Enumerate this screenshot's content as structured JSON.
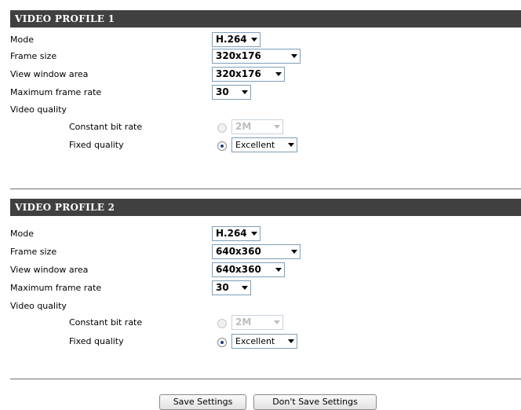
{
  "profiles": [
    {
      "title": "VIDEO PROFILE 1",
      "mode_label": "Mode",
      "mode_value": "H.264",
      "frame_size_label": "Frame size",
      "frame_size_value": "320x176",
      "view_window_label": "View window area",
      "view_window_value": "320x176",
      "max_frame_rate_label": "Maximum frame rate",
      "max_frame_rate_value": "30",
      "video_quality_label": "Video quality",
      "cbr_label": "Constant bit rate",
      "cbr_value": "2M",
      "fixed_quality_label": "Fixed quality",
      "fixed_quality_value": "Excellent",
      "selected_quality_mode": "fixed"
    },
    {
      "title": "VIDEO PROFILE 2",
      "mode_label": "Mode",
      "mode_value": "H.264",
      "frame_size_label": "Frame size",
      "frame_size_value": "640x360",
      "view_window_label": "View window area",
      "view_window_value": "640x360",
      "max_frame_rate_label": "Maximum frame rate",
      "max_frame_rate_value": "30",
      "video_quality_label": "Video quality",
      "cbr_label": "Constant bit rate",
      "cbr_value": "2M",
      "fixed_quality_label": "Fixed quality",
      "fixed_quality_value": "Excellent",
      "selected_quality_mode": "fixed"
    }
  ],
  "buttons": {
    "save": "Save Settings",
    "dont_save": "Don't Save Settings"
  },
  "colors": {
    "header_bg": "#404040",
    "header_text": "#ffffff"
  }
}
